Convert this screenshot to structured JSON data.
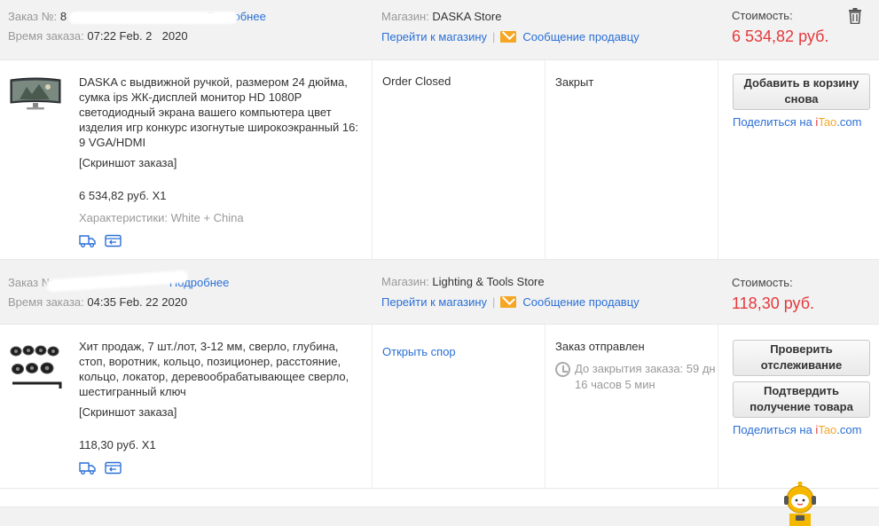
{
  "orders": [
    {
      "order_label": "Заказ №:",
      "order_number_partial": "8",
      "details_link": "Подробнее",
      "time_label": "Время заказа:",
      "time_value": "07:22 Feb. 2",
      "time_year_partial": "2020",
      "store_label": "Магазин:",
      "store_name": "DASKA Store",
      "go_to_store": "Перейти к магазину",
      "separator": "|",
      "message_seller": "Сообщение продавцу",
      "cost_label": "Стоимость:",
      "cost_value": "6 534,82 руб.",
      "product_title": "DASKA с выдвижной ручкой, размером 24 дюйма, сумка ips ЖК-дисплей монитор HD 1080P светодиодный экрана вашего компьютера цвет изделия игр конкурс изогнутые широкоэкранный 16: 9 VGA/HDMI",
      "snapshot": "[Скриншот заказа]",
      "price_qty": "6 534,82 руб. X1",
      "specs": "Характеристики: White + China",
      "status_mid": "Order Closed",
      "status_right": "Закрыт",
      "buttons": [
        "Добавить в корзину снова"
      ],
      "share_prefix": "Поделиться на ",
      "share_i": "i",
      "share_tao": "Tao",
      "share_com": ".com",
      "icons": {
        "trash": "trash-icon",
        "mail": "mail-icon",
        "shipping": "shipping-icon",
        "return": "return-icon"
      }
    },
    {
      "order_label": "Заказ №",
      "order_number_partial": "",
      "details_link": "Подробнее",
      "time_label": "Время заказа:",
      "time_value": "04:35 Feb. 22 2020",
      "store_label": "Магазин:",
      "store_name": "Lighting & Tools Store",
      "go_to_store": "Перейти к магазину",
      "separator": "|",
      "message_seller": "Сообщение продавцу",
      "cost_label": "Стоимость:",
      "cost_value": "118,30 руб.",
      "product_title": "Хит продаж, 7 шт./лот, 3-12 мм, сверло, глубина, стоп, воротник, кольцо, позиционер, расстояние, кольцо, локатор, деревообрабатывающее сверло, шестигранный ключ",
      "snapshot": "[Скриншот заказа]",
      "price_qty": "118,30 руб. X1",
      "status_mid": "Открыть спор",
      "status_right": "Заказ отправлен",
      "timer_text": "До закрытия заказа: 59 дн 16 часов 5 мин",
      "buttons": [
        "Проверить отслеживание",
        "Подтвердить получение товара"
      ],
      "share_prefix": "Поделиться на ",
      "share_i": "i",
      "share_tao": "Tao",
      "share_com": ".com",
      "icons": {
        "mail": "mail-icon",
        "shipping": "shipping-icon",
        "return": "return-icon",
        "clock": "clock-icon"
      }
    }
  ],
  "assistant": {
    "icon": "robot-assistant-icon"
  },
  "colors": {
    "accent_link": "#2a6fd6",
    "price_red": "#e4393c",
    "mail_orange": "#f5a623",
    "header_bg": "#f2f2f2"
  }
}
